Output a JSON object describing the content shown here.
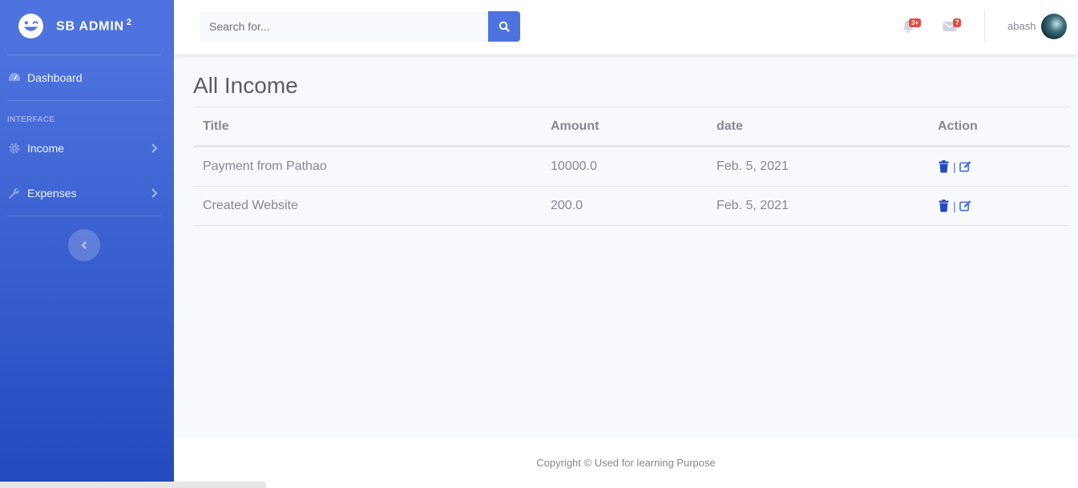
{
  "brand": {
    "name": "SB ADMIN",
    "superscript": "2"
  },
  "sidebar": {
    "dashboard_label": "Dashboard",
    "section_heading": "INTERFACE",
    "income_label": "Income",
    "expenses_label": "Expenses"
  },
  "topbar": {
    "search_placeholder": "Search for...",
    "alerts_badge": "3+",
    "messages_badge": "7",
    "user_name": "abash"
  },
  "page": {
    "title": "All Income",
    "table": {
      "headers": {
        "title": "Title",
        "amount": "Amount",
        "date": "date",
        "action": "Action"
      },
      "rows": [
        {
          "title": "Payment from Pathao",
          "amount": "10000.0",
          "date": "Feb. 5, 2021"
        },
        {
          "title": "Created Website",
          "amount": "200.0",
          "date": "Feb. 5, 2021"
        }
      ],
      "action_separator": "|"
    }
  },
  "footer": {
    "text": "Copyright © Used for learning Purpose"
  },
  "colors": {
    "primary": "#4e73df",
    "sidebar_end": "#224abe",
    "danger": "#e74a3b",
    "text": "#858796"
  }
}
